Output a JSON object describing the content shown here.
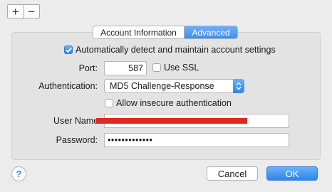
{
  "toolbar": {
    "plus": "+",
    "minus": "−"
  },
  "tabs": [
    {
      "label": "Account Information",
      "active": false
    },
    {
      "label": "Advanced",
      "active": true
    }
  ],
  "auto_detect": {
    "label": "Automatically detect and maintain account settings",
    "checked": true
  },
  "port": {
    "label": "Port:",
    "value": "587"
  },
  "use_ssl": {
    "label": "Use SSL",
    "checked": false
  },
  "authentication": {
    "label": "Authentication:",
    "value": "MD5 Challenge-Response"
  },
  "insecure_auth": {
    "label": "Allow insecure authentication",
    "checked": false
  },
  "username": {
    "label": "User Name:",
    "value": ""
  },
  "password": {
    "label": "Password:",
    "value": "•••••••••••••"
  },
  "help": {
    "label": "?"
  },
  "buttons": {
    "cancel": "Cancel",
    "ok": "OK"
  },
  "colors": {
    "accent": "#3f8ef0",
    "redaction": "#e0291f"
  }
}
